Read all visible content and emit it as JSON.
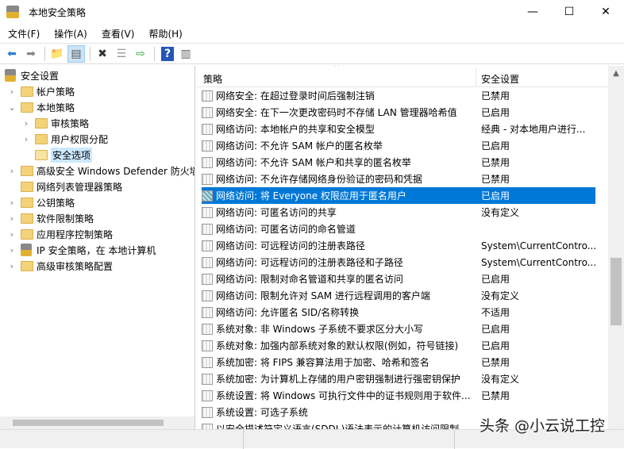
{
  "window": {
    "title": "本地安全策略",
    "minimize": "—",
    "maximize": "☐",
    "close": "✕"
  },
  "menu": [
    "文件(F)",
    "操作(A)",
    "查看(V)",
    "帮助(H)"
  ],
  "toolbar": {
    "back": "back-icon",
    "forward": "forward-icon",
    "up": "up-folder-icon",
    "show_hide_tree": "console-tree-icon",
    "delete": "delete-icon",
    "properties": "properties-icon",
    "export": "export-list-icon",
    "help": "help-icon",
    "action_pane": "action-pane-icon"
  },
  "tree": [
    {
      "label": "安全设置",
      "level": 0,
      "type": "root"
    },
    {
      "label": "帐户策略",
      "level": 1,
      "type": "folder",
      "chevron": "›"
    },
    {
      "label": "本地策略",
      "level": 1,
      "type": "folder",
      "chevron": "⌄"
    },
    {
      "label": "审核策略",
      "level": 2,
      "type": "folder",
      "chevron": "›"
    },
    {
      "label": "用户权限分配",
      "level": 2,
      "type": "folder",
      "chevron": "›"
    },
    {
      "label": "安全选项",
      "level": 2,
      "type": "folder-open",
      "chevron": ""
    },
    {
      "label": "高级安全 Windows Defender 防火墙",
      "level": 1,
      "type": "folder",
      "chevron": "›"
    },
    {
      "label": "网络列表管理器策略",
      "level": 1,
      "type": "folder",
      "chevron": ""
    },
    {
      "label": "公钥策略",
      "level": 1,
      "type": "folder",
      "chevron": "›"
    },
    {
      "label": "软件限制策略",
      "level": 1,
      "type": "folder",
      "chevron": "›"
    },
    {
      "label": "应用程序控制策略",
      "level": 1,
      "type": "folder",
      "chevron": "›"
    },
    {
      "label": "IP 安全策略，在 本地计算机",
      "level": 1,
      "type": "ipsec",
      "chevron": "›"
    },
    {
      "label": "高级审核策略配置",
      "level": 1,
      "type": "folder",
      "chevron": "›"
    }
  ],
  "list": {
    "col_policy": "策略",
    "col_setting": "安全设置",
    "selected_index": 6,
    "rows": [
      {
        "policy": "网络安全: 在超过登录时间后强制注销",
        "setting": "已禁用"
      },
      {
        "policy": "网络安全: 在下一次更改密码时不存储 LAN 管理器哈希值",
        "setting": "已启用"
      },
      {
        "policy": "网络访问: 本地帐户的共享和安全模型",
        "setting": "经典 - 对本地用户进行..."
      },
      {
        "policy": "网络访问: 不允许 SAM 帐户的匿名枚举",
        "setting": "已启用"
      },
      {
        "policy": "网络访问: 不允许 SAM 帐户和共享的匿名枚举",
        "setting": "已禁用"
      },
      {
        "policy": "网络访问: 不允许存储网络身份验证的密码和凭据",
        "setting": "已禁用"
      },
      {
        "policy": "网络访问: 将 Everyone 权限应用于匿名用户",
        "setting": "已启用"
      },
      {
        "policy": "网络访问: 可匿名访问的共享",
        "setting": "没有定义"
      },
      {
        "policy": "网络访问: 可匿名访问的命名管道",
        "setting": ""
      },
      {
        "policy": "网络访问: 可远程访问的注册表路径",
        "setting": "System\\CurrentContro..."
      },
      {
        "policy": "网络访问: 可远程访问的注册表路径和子路径",
        "setting": "System\\CurrentContro..."
      },
      {
        "policy": "网络访问: 限制对命名管道和共享的匿名访问",
        "setting": "已启用"
      },
      {
        "policy": "网络访问: 限制允许对 SAM 进行远程调用的客户端",
        "setting": "没有定义"
      },
      {
        "policy": "网络访问: 允许匿名 SID/名称转换",
        "setting": "不适用"
      },
      {
        "policy": "系统对象: 非 Windows 子系统不要求区分大小写",
        "setting": "已启用"
      },
      {
        "policy": "系统对象: 加强内部系统对象的默认权限(例如，符号链接)",
        "setting": "已启用"
      },
      {
        "policy": "系统加密: 将 FIPS 兼容算法用于加密、哈希和签名",
        "setting": "已禁用"
      },
      {
        "policy": "系统加密: 为计算机上存储的用户密钥强制进行强密钥保护",
        "setting": "没有定义"
      },
      {
        "policy": "系统设置: 将 Windows 可执行文件中的证书规则用于软件...",
        "setting": "已禁用"
      },
      {
        "policy": "系统设置: 可选子系统",
        "setting": ""
      },
      {
        "policy": "以安全描述符定义语言(SDDL)语法表示的计算机访问限制",
        "setting": ""
      }
    ]
  },
  "watermark": "头条 @小云说工控"
}
